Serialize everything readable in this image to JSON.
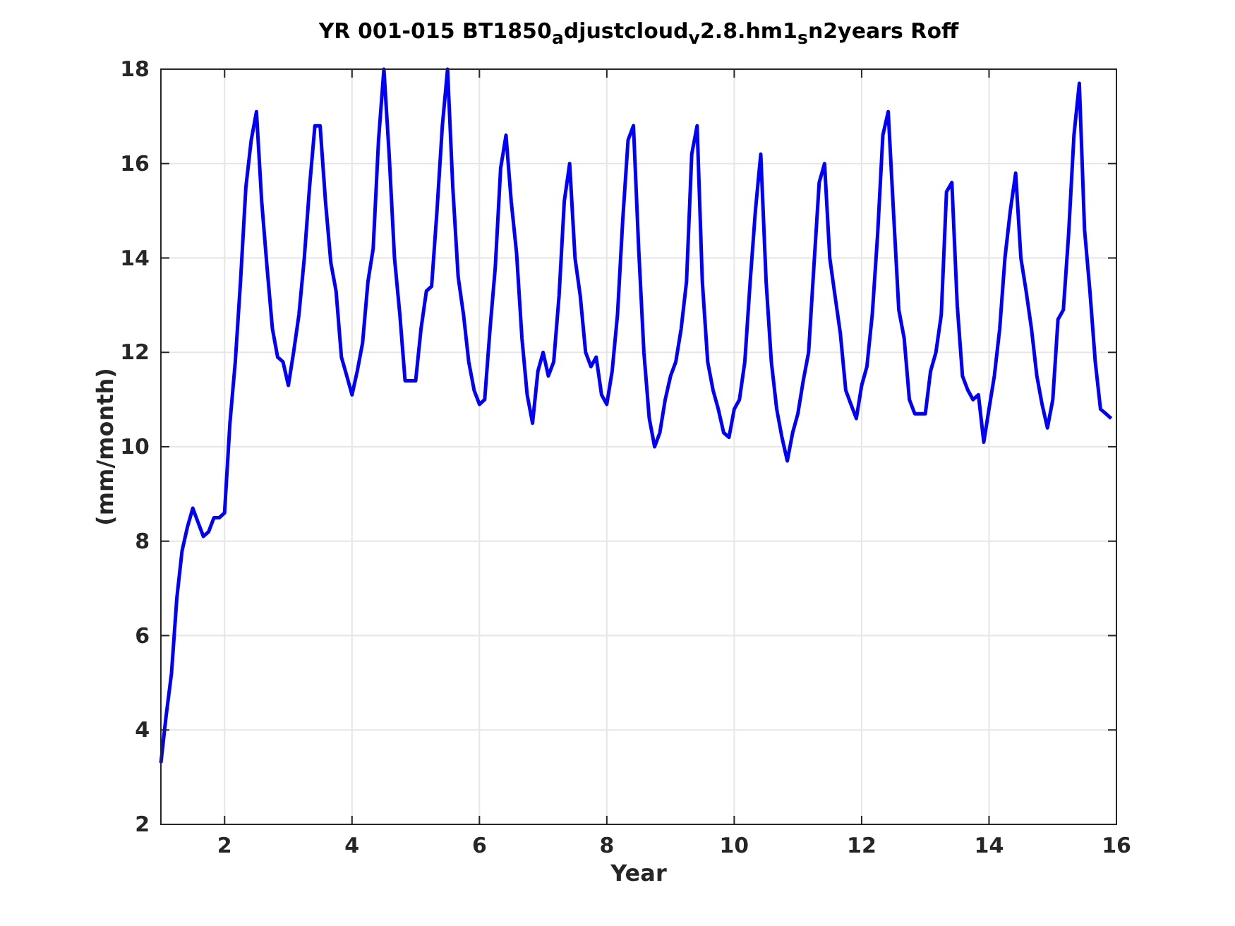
{
  "figure": {
    "chart_data": {
      "type": "line",
      "title": "YR 001-015 BT1850$_{a}$djustcloud$_{v}$2.8.hm1$_{s}$n2years Roff",
      "xlabel": "Year",
      "ylabel": "(mm/month)",
      "grid": true,
      "xlim": [
        1,
        16
      ],
      "ylim": [
        2,
        18
      ],
      "xticks": [
        2,
        4,
        6,
        8,
        10,
        12,
        14,
        16
      ],
      "yticks": [
        2,
        4,
        6,
        8,
        10,
        12,
        14,
        16,
        18
      ],
      "x": [
        1,
        1.083,
        1.167,
        1.25,
        1.333,
        1.417,
        1.5,
        1.583,
        1.667,
        1.75,
        1.833,
        1.917,
        2,
        2.083,
        2.167,
        2.25,
        2.333,
        2.417,
        2.5,
        2.583,
        2.667,
        2.75,
        2.833,
        2.917,
        3,
        3.083,
        3.167,
        3.25,
        3.333,
        3.417,
        3.5,
        3.583,
        3.667,
        3.75,
        3.833,
        3.917,
        4,
        4.083,
        4.167,
        4.25,
        4.333,
        4.417,
        4.5,
        4.583,
        4.667,
        4.75,
        4.833,
        4.917,
        5,
        5.083,
        5.167,
        5.25,
        5.333,
        5.417,
        5.5,
        5.583,
        5.667,
        5.75,
        5.833,
        5.917,
        6,
        6.083,
        6.167,
        6.25,
        6.333,
        6.417,
        6.5,
        6.583,
        6.667,
        6.75,
        6.833,
        6.917,
        7,
        7.083,
        7.167,
        7.25,
        7.333,
        7.417,
        7.5,
        7.583,
        7.667,
        7.75,
        7.833,
        7.917,
        8,
        8.083,
        8.167,
        8.25,
        8.333,
        8.417,
        8.5,
        8.583,
        8.667,
        8.75,
        8.833,
        8.917,
        9,
        9.083,
        9.167,
        9.25,
        9.333,
        9.417,
        9.5,
        9.583,
        9.667,
        9.75,
        9.833,
        9.917,
        10,
        10.083,
        10.167,
        10.25,
        10.333,
        10.417,
        10.5,
        10.583,
        10.667,
        10.75,
        10.833,
        10.917,
        11,
        11.083,
        11.167,
        11.25,
        11.333,
        11.417,
        11.5,
        11.583,
        11.667,
        11.75,
        11.833,
        11.917,
        12,
        12.083,
        12.167,
        12.25,
        12.333,
        12.417,
        12.5,
        12.583,
        12.667,
        12.75,
        12.833,
        12.917,
        13,
        13.083,
        13.167,
        13.25,
        13.333,
        13.417,
        13.5,
        13.583,
        13.667,
        13.75,
        13.833,
        13.917,
        14,
        14.083,
        14.167,
        14.25,
        14.333,
        14.417,
        14.5,
        14.583,
        14.667,
        14.75,
        14.833,
        14.917,
        15,
        15.083,
        15.167,
        15.25,
        15.333,
        15.417,
        15.5,
        15.583,
        15.667,
        15.75,
        15.833,
        15.917
      ],
      "series": [
        {
          "color": "#0000ff",
          "values": [
            3.3,
            4.3,
            5.2,
            6.8,
            7.8,
            8.3,
            8.7,
            8.4,
            8.1,
            8.2,
            8.5,
            8.5,
            8.6,
            10.5,
            11.8,
            13.5,
            15.5,
            16.5,
            17.1,
            15.2,
            13.8,
            12.5,
            11.9,
            11.8,
            11.3,
            12.0,
            12.8,
            14.0,
            15.5,
            16.8,
            16.8,
            15.2,
            13.9,
            13.3,
            11.9,
            11.5,
            11.1,
            11.6,
            12.2,
            13.5,
            14.2,
            16.5,
            18.0,
            16.2,
            14.0,
            12.8,
            11.4,
            11.4,
            11.4,
            12.5,
            13.3,
            13.4,
            15.0,
            16.8,
            18.0,
            15.5,
            13.6,
            12.8,
            11.8,
            11.2,
            10.9,
            11.0,
            12.5,
            13.8,
            15.9,
            16.6,
            15.2,
            14.1,
            12.3,
            11.1,
            10.5,
            11.6,
            12.0,
            11.5,
            11.8,
            13.2,
            15.2,
            16.0,
            14.0,
            13.2,
            12.0,
            11.7,
            11.9,
            11.1,
            10.9,
            11.6,
            12.8,
            14.8,
            16.5,
            16.8,
            14.2,
            12.0,
            10.6,
            10.0,
            10.3,
            11.0,
            11.5,
            11.8,
            12.5,
            13.5,
            16.2,
            16.8,
            13.5,
            11.8,
            11.2,
            10.8,
            10.3,
            10.2,
            10.8,
            11.0,
            11.8,
            13.5,
            15.0,
            16.2,
            13.5,
            11.8,
            10.8,
            10.2,
            9.7,
            10.3,
            10.7,
            11.4,
            12.0,
            13.8,
            15.6,
            16.0,
            14.0,
            13.2,
            12.4,
            11.2,
            10.9,
            10.6,
            11.3,
            11.7,
            12.8,
            14.5,
            16.6,
            17.1,
            15.0,
            12.9,
            12.3,
            11.0,
            10.7,
            10.7,
            10.7,
            11.6,
            12.0,
            12.8,
            15.4,
            15.6,
            13.0,
            11.5,
            11.2,
            11.0,
            11.1,
            10.1,
            10.8,
            11.5,
            12.5,
            14.0,
            15.0,
            15.8,
            14.0,
            13.3,
            12.5,
            11.5,
            10.9,
            10.4,
            11.0,
            12.7,
            12.9,
            14.5,
            16.6,
            17.7,
            14.6,
            13.3,
            11.8,
            10.8,
            10.7,
            10.6
          ]
        }
      ]
    }
  }
}
